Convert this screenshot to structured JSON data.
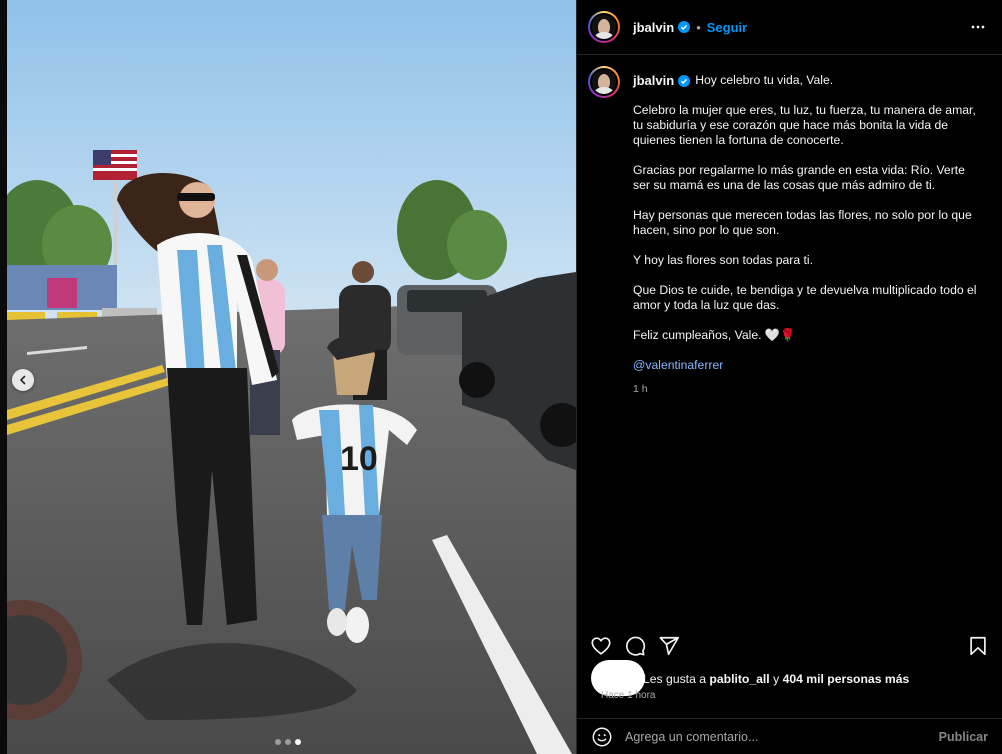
{
  "post": {
    "username": "jbalvin",
    "follow_label": "Seguir",
    "separator": "•",
    "more_icon": "more-horizontal-icon",
    "verified_color": "#0095f6"
  },
  "caption": {
    "username": "jbalvin",
    "first_line": "Hoy celebro tu vida, Vale.",
    "paragraphs": [
      "Celebro la mujer que eres, tu luz, tu fuerza, tu manera de amar, tu sabiduría y ese corazón que hace más bonita la vida de quienes tienen la fortuna de conocerte.",
      "Gracias por regalarme lo más grande en esta vida: Río. Verte ser su mamá es una de las cosas que más admiro de ti.",
      "Hay personas que merecen todas las flores, no solo por lo que hacen, sino por lo que son.",
      "Y hoy las flores son todas para ti.",
      "Que Dios te cuide, te bendiga y te devuelva multiplicado todo el amor y toda la luz que das.",
      "Feliz cumpleaños, Vale. 🤍🌹"
    ],
    "mention": "@valentinaferrer",
    "time": "1 h"
  },
  "actions": {
    "like_icon": "heart-icon",
    "comment_icon": "comment-icon",
    "share_icon": "share-icon",
    "save_icon": "bookmark-icon"
  },
  "likes": {
    "prefix": "Les gusta a ",
    "user": "pablito_all",
    "middle": " y ",
    "count": "404 mil personas más",
    "time": "Hace 1 hora"
  },
  "comment": {
    "placeholder": "Agrega un comentario...",
    "publish_label": "Publicar"
  },
  "carousel": {
    "total": 3,
    "active_index": 2,
    "prev_icon": "chevron-left-icon"
  }
}
